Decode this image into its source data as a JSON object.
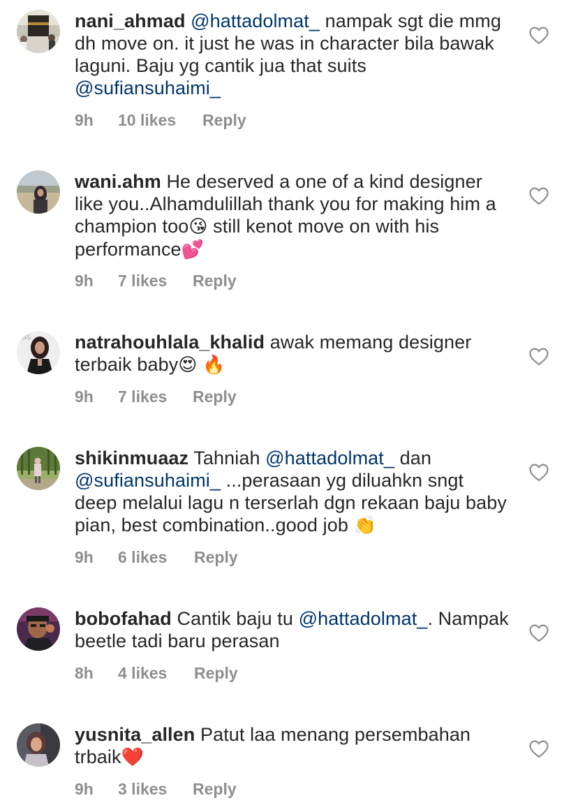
{
  "colors": {
    "text": "#262626",
    "muted": "#8e8e8e",
    "mention": "#003569",
    "heart_outline": "#8e8e8e"
  },
  "comments": [
    {
      "username": "nani_ahmad",
      "parts": [
        {
          "type": "mention",
          "text": "@hattadolmat_"
        },
        {
          "type": "text",
          "text": " nampak sgt die mmg dh move on. it just he was in character bila bawak laguni. Baju yg cantik jua that suits "
        },
        {
          "type": "mention",
          "text": "@sufiansuhaimi_"
        }
      ],
      "time": "9h",
      "likes": "10 likes",
      "reply": "Reply",
      "like_icon": "heart-outline-icon"
    },
    {
      "username": "wani.ahm",
      "parts": [
        {
          "type": "text",
          "text": "He deserved a one of a kind designer like you..Alhamdulillah thank you for making him a champion too"
        },
        {
          "type": "emoji",
          "text": "😘"
        },
        {
          "type": "text",
          "text": "  still kenot move on with his performance"
        },
        {
          "type": "emoji",
          "text": "💕"
        }
      ],
      "time": "9h",
      "likes": "7 likes",
      "reply": "Reply",
      "like_icon": "heart-outline-icon"
    },
    {
      "username": "natrahouhlala_khalid",
      "parts": [
        {
          "type": "text",
          "text": "awak memang designer terbaik baby"
        },
        {
          "type": "emoji",
          "text": "😍"
        },
        {
          "type": "text",
          "text": " "
        },
        {
          "type": "emoji",
          "text": "🔥"
        }
      ],
      "time": "9h",
      "likes": "7 likes",
      "reply": "Reply",
      "like_icon": "heart-outline-icon"
    },
    {
      "username": "shikinmuaaz",
      "parts": [
        {
          "type": "text",
          "text": "Tahniah "
        },
        {
          "type": "mention",
          "text": "@hattadolmat_"
        },
        {
          "type": "text",
          "text": "  dan "
        },
        {
          "type": "mention",
          "text": "@sufiansuhaimi_"
        },
        {
          "type": "text",
          "text": " ...perasaan yg diluahkn sngt deep melalui lagu n terserlah dgn rekaan baju baby pian, best combination..good job "
        },
        {
          "type": "emoji",
          "text": "👏"
        }
      ],
      "time": "9h",
      "likes": "6 likes",
      "reply": "Reply",
      "like_icon": "heart-outline-icon"
    },
    {
      "username": "bobofahad",
      "parts": [
        {
          "type": "text",
          "text": "Cantik baju tu "
        },
        {
          "type": "mention",
          "text": "@hattadolmat_"
        },
        {
          "type": "text",
          "text": ". Nampak beetle tadi baru perasan"
        }
      ],
      "time": "8h",
      "likes": "4 likes",
      "reply": "Reply",
      "like_icon": "heart-outline-icon"
    },
    {
      "username": "yusnita_allen",
      "parts": [
        {
          "type": "text",
          "text": "Patut laa menang persembahan trbaik"
        },
        {
          "type": "emoji",
          "text": "❤️"
        }
      ],
      "time": "9h",
      "likes": "3 likes",
      "reply": "Reply",
      "like_icon": "heart-outline-icon"
    }
  ]
}
